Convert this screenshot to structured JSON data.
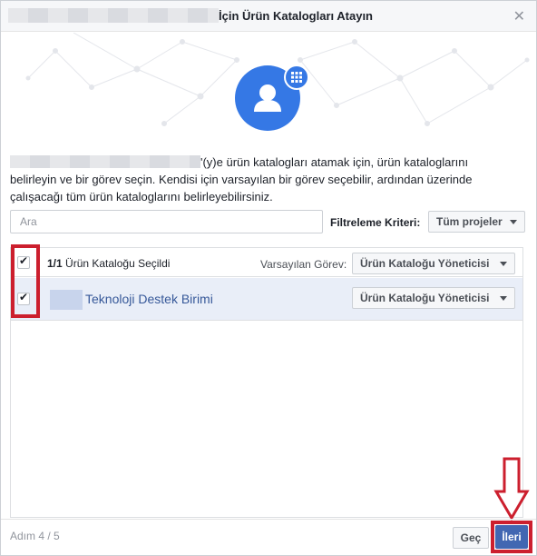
{
  "header": {
    "title": "İçin Ürün Katalogları Atayın",
    "close_icon": "close-icon"
  },
  "hero": {
    "avatar_icon": "person-icon",
    "badge_icon": "grid-icon"
  },
  "description": {
    "line1_suffix": "'(y)e ürün katalogları atamak için, ürün kataloglarını",
    "line2": "belirleyin ve bir görev seçin. Kendisi için varsayılan bir görev seçebilir, ardından üzerinde",
    "line3": "çalışacağı tüm ürün kataloglarını belirleyebilirsiniz."
  },
  "search": {
    "placeholder": "Ara",
    "value": ""
  },
  "filter": {
    "label": "Filtreleme Kriteri:",
    "selected": "Tüm projeler"
  },
  "table": {
    "header": {
      "checked": true,
      "count": "1/1",
      "selected_text": "Ürün Kataloğu Seçildi",
      "default_role_label": "Varsayılan Görev:",
      "default_role_value": "Ürün Kataloğu Yöneticisi"
    },
    "rows": [
      {
        "checked": true,
        "name": "Teknoloji Destek Birimi",
        "role": "Ürün Kataloğu Yöneticisi"
      }
    ]
  },
  "footer": {
    "step": "Adım 4 / 5",
    "skip_label": "Geç",
    "next_label": "İleri"
  },
  "colors": {
    "primary": "#4267b2",
    "avatar_bg": "#3578e5",
    "annotation_red": "#cc1f2e",
    "row_selected_bg": "#e9eef8",
    "link": "#365899"
  }
}
